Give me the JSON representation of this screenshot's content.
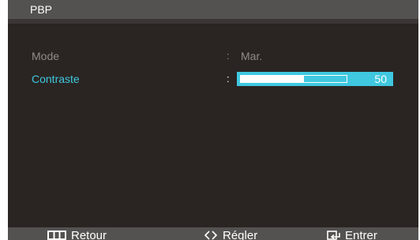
{
  "header": {
    "title": "PBP"
  },
  "menu": {
    "mode": {
      "label": "Mode",
      "separator": ":",
      "value": "Mar."
    },
    "contrast": {
      "label": "Contraste",
      "separator": ":",
      "value": "50",
      "level_fraction": 0.59
    }
  },
  "footer": {
    "back": {
      "label": "Retour",
      "icon": "menu-icon"
    },
    "adjust": {
      "label": "Régler",
      "icon": "diamond-arrows-icon"
    },
    "enter": {
      "label": "Entrer",
      "icon": "enter-icon"
    }
  },
  "colors": {
    "panel": "#2a2523",
    "bar": "#545251",
    "highlight": "#3fc8e0",
    "dim_text": "#918b88"
  }
}
